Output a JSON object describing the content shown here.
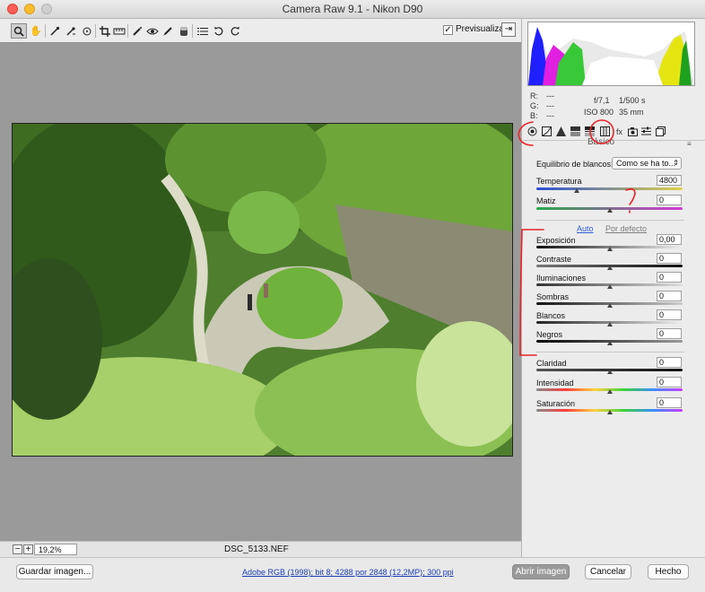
{
  "window": {
    "title": "Camera Raw 9.1 -  Nikon D90"
  },
  "toolbar": {
    "tools": [
      "zoom-tool-icon",
      "hand-tool-icon",
      "white-balance-tool-icon",
      "color-sampler-icon",
      "targeted-adjustment-icon",
      "crop-tool-icon",
      "straighten-tool-icon",
      "spot-removal-icon",
      "red-eye-icon",
      "adjustment-brush-icon",
      "graduated-filter-icon",
      "radial-filter-icon",
      "preferences-icon",
      "rotate-left-icon",
      "rotate-right-icon"
    ],
    "preview_label": "Previsualizar",
    "preview_checked": true
  },
  "info": {
    "r_label": "R:",
    "g_label": "G:",
    "b_label": "B:",
    "r_value": "---",
    "g_value": "---",
    "b_value": "---",
    "aperture": "f/7,1",
    "shutter": "1/500 s",
    "iso": "ISO 800",
    "focal": "35 mm"
  },
  "panel": {
    "title": "Básico",
    "tabs": [
      "basic-panel-icon",
      "tone-curve-icon",
      "detail-icon",
      "hsl-icon",
      "split-toning-icon",
      "lens-corrections-icon",
      "effects-icon",
      "camera-calibration-icon",
      "presets-icon",
      "snapshots-icon"
    ],
    "white_balance_label": "Equilibrio de blancos:",
    "white_balance_value": "Como se ha to...",
    "temperature_label": "Temperatura",
    "temperature_value": "4800",
    "tint_label": "Matiz",
    "tint_value": "0",
    "auto_label": "Auto",
    "default_label": "Por defecto",
    "sliders": [
      {
        "label": "Exposición",
        "value": "0,00"
      },
      {
        "label": "Contraste",
        "value": "0"
      },
      {
        "label": "Iluminaciones",
        "value": "0"
      },
      {
        "label": "Sombras",
        "value": "0"
      },
      {
        "label": "Blancos",
        "value": "0"
      },
      {
        "label": "Negros",
        "value": "0"
      }
    ],
    "presence": [
      {
        "label": "Claridad",
        "value": "0"
      },
      {
        "label": "Intensidad",
        "value": "0"
      },
      {
        "label": "Saturación",
        "value": "0"
      }
    ]
  },
  "status": {
    "zoom": "19,2%",
    "filename": "DSC_5133.NEF"
  },
  "bottom": {
    "save_label": "Guardar imagen...",
    "workflow_link": "Adobe RGB (1998); bit 8; 4288 por 2848 (12,2MP); 300 ppi",
    "open_label": "Abrir imagen",
    "cancel_label": "Cancelar",
    "done_label": "Hecho"
  },
  "colors": {
    "annotation": "#e8242a",
    "accent": "#2f5bd8"
  }
}
